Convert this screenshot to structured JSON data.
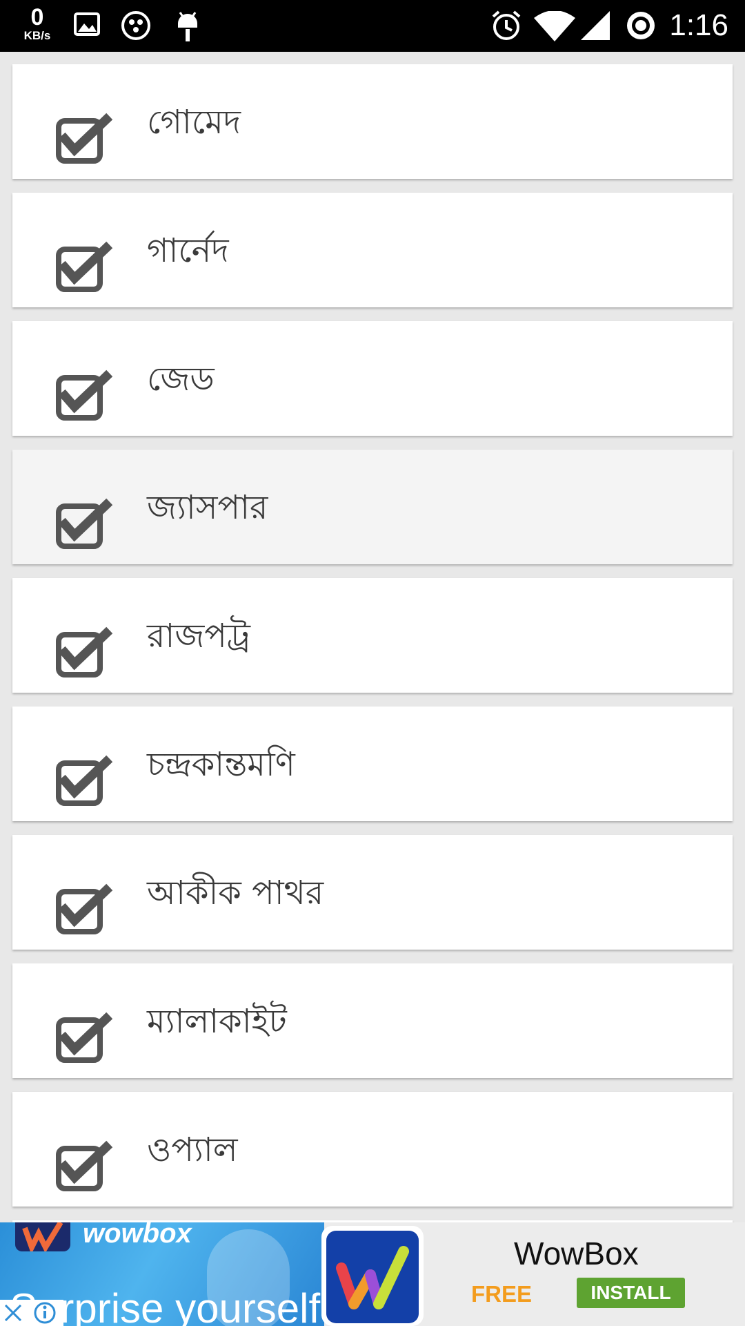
{
  "status_bar": {
    "speed_value": "0",
    "speed_unit": "KB/s",
    "time": "1:16",
    "icons": [
      "image-icon",
      "app-icon",
      "android-debug-icon",
      "alarm-icon",
      "wifi-icon",
      "signal-icon",
      "sync-icon"
    ]
  },
  "items": [
    {
      "label": "গোমেদ",
      "checked": true
    },
    {
      "label": "গার্নেদ",
      "checked": true
    },
    {
      "label": "জেড",
      "checked": true
    },
    {
      "label": "জ্যাসপার",
      "checked": true
    },
    {
      "label": "রাজপট্র",
      "checked": true
    },
    {
      "label": "চন্দ্রকান্তমণি",
      "checked": true
    },
    {
      "label": "আকীক পাথর",
      "checked": true
    },
    {
      "label": "ম্যালাকাইট",
      "checked": true
    },
    {
      "label": "ওপ্যাল",
      "checked": true
    }
  ],
  "ad": {
    "brand": "wowbox",
    "tagline": "Surprise yourself",
    "title": "WowBox",
    "price": "FREE",
    "install_label": "INSTALL"
  }
}
